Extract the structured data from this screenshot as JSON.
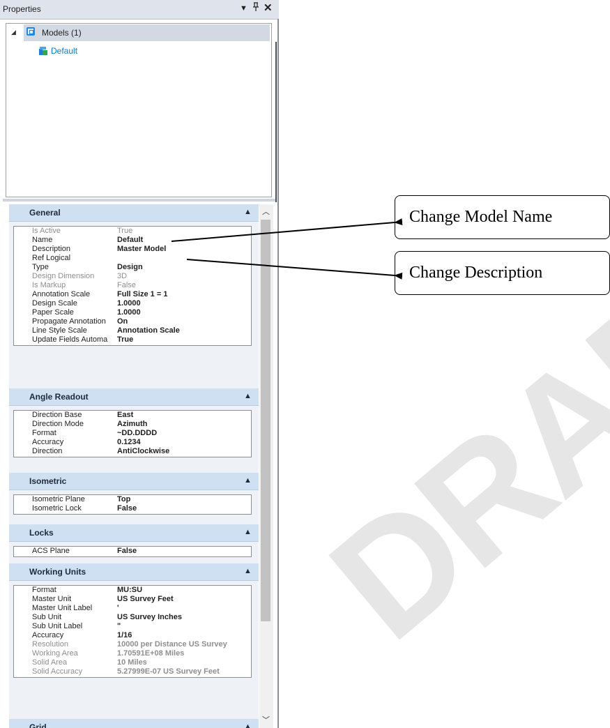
{
  "panel": {
    "title": "Properties",
    "controls": {
      "menu": "▼",
      "pin": "ᵖ",
      "close": "✕"
    }
  },
  "tree": {
    "models_label": "Models (1)",
    "default_label": "Default"
  },
  "sections": [
    {
      "title": "General",
      "rows": [
        {
          "name": "Is Active",
          "value": "True",
          "state": "dim"
        },
        {
          "name": "Name",
          "value": "Default",
          "state": "normal"
        },
        {
          "name": "Description",
          "value": "Master Model",
          "state": "normal"
        },
        {
          "name": "Ref Logical",
          "value": "",
          "state": "normal"
        },
        {
          "name": "Type",
          "value": "Design",
          "state": "normal"
        },
        {
          "name": "Design Dimension",
          "value": "3D",
          "state": "dim"
        },
        {
          "name": "Is Markup",
          "value": "False",
          "state": "dim"
        },
        {
          "name": "Annotation Scale",
          "value": "Full Size 1 = 1",
          "state": "normal"
        },
        {
          "name": "Design Scale",
          "value": "1.0000",
          "state": "normal"
        },
        {
          "name": "Paper Scale",
          "value": "1.0000",
          "state": "normal"
        },
        {
          "name": "Propagate Annotation",
          "value": "On",
          "state": "normal"
        },
        {
          "name": "Line Style Scale",
          "value": "Annotation Scale",
          "state": "normal"
        },
        {
          "name": "Update Fields Automa",
          "value": "True",
          "state": "normal"
        }
      ]
    },
    {
      "title": "Angle Readout",
      "rows": [
        {
          "name": "Direction Base",
          "value": "East",
          "state": "normal"
        },
        {
          "name": "Direction Mode",
          "value": "Azimuth",
          "state": "normal"
        },
        {
          "name": "Format",
          "value": "~DD.DDDD",
          "state": "normal"
        },
        {
          "name": "Accuracy",
          "value": "0.1234",
          "state": "normal"
        },
        {
          "name": "Direction",
          "value": "AntiClockwise",
          "state": "normal"
        }
      ]
    },
    {
      "title": "Isometric",
      "rows": [
        {
          "name": "Isometric Plane",
          "value": "Top",
          "state": "normal"
        },
        {
          "name": "Isometric Lock",
          "value": "False",
          "state": "normal"
        }
      ]
    },
    {
      "title": "Locks",
      "rows": [
        {
          "name": "ACS Plane",
          "value": "False",
          "state": "normal"
        }
      ]
    },
    {
      "title": "Working Units",
      "rows": [
        {
          "name": "Format",
          "value": "MU:SU",
          "state": "normal"
        },
        {
          "name": "Master Unit",
          "value": "US Survey Feet",
          "state": "normal"
        },
        {
          "name": "Master Unit Label",
          "value": "'",
          "state": "normal"
        },
        {
          "name": "Sub Unit",
          "value": "US Survey Inches",
          "state": "normal"
        },
        {
          "name": "Sub Unit Label",
          "value": "\"",
          "state": "normal"
        },
        {
          "name": "Accuracy",
          "value": "1/16",
          "state": "normal"
        },
        {
          "name": "Resolution",
          "value": "10000 per Distance US Survey",
          "state": "dimbold"
        },
        {
          "name": "Working Area",
          "value": "1.70591E+08 Miles",
          "state": "dimbold"
        },
        {
          "name": "Solid Area",
          "value": "10 Miles",
          "state": "dimbold"
        },
        {
          "name": "Solid Accuracy",
          "value": "5.27999E-07 US Survey Feet",
          "state": "dimbold"
        }
      ]
    },
    {
      "title": "Grid",
      "rows": []
    }
  ],
  "callouts": {
    "model_name": "Change Model Name",
    "description": "Change Description"
  },
  "watermark": "DRAFT"
}
